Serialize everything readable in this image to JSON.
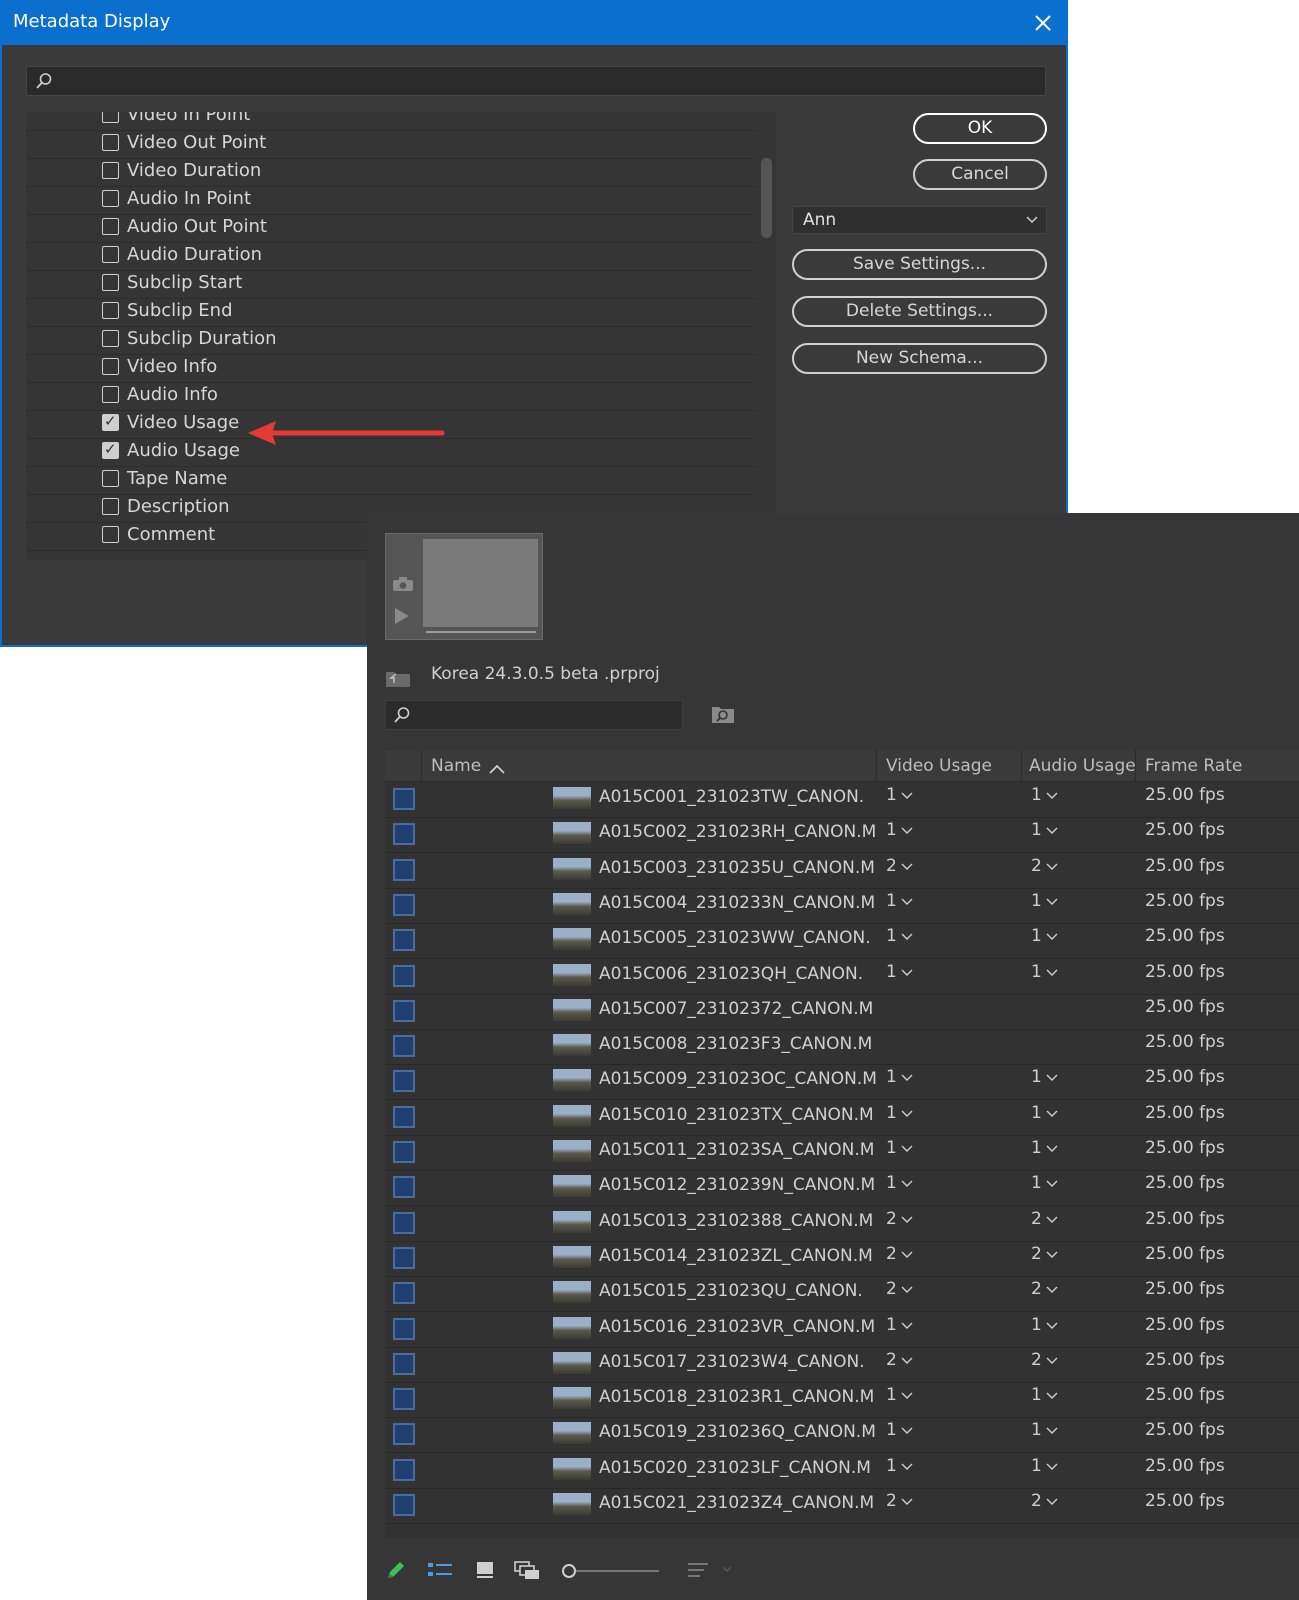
{
  "dialog": {
    "title": "Metadata Display",
    "search_placeholder": "",
    "fields": [
      {
        "label": "Video In Point",
        "checked": false
      },
      {
        "label": "Video Out Point",
        "checked": false
      },
      {
        "label": "Video Duration",
        "checked": false
      },
      {
        "label": "Audio In Point",
        "checked": false
      },
      {
        "label": "Audio Out Point",
        "checked": false
      },
      {
        "label": "Audio Duration",
        "checked": false
      },
      {
        "label": "Subclip Start",
        "checked": false
      },
      {
        "label": "Subclip End",
        "checked": false
      },
      {
        "label": "Subclip Duration",
        "checked": false
      },
      {
        "label": "Video Info",
        "checked": false
      },
      {
        "label": "Audio Info",
        "checked": false
      },
      {
        "label": "Video Usage",
        "checked": true
      },
      {
        "label": "Audio Usage",
        "checked": true
      },
      {
        "label": "Tape Name",
        "checked": false
      },
      {
        "label": "Description",
        "checked": false
      },
      {
        "label": "Comment",
        "checked": false
      }
    ],
    "ok_label": "OK",
    "cancel_label": "Cancel",
    "preset_value": "Ann",
    "save_label": "Save Settings...",
    "delete_label": "Delete Settings...",
    "schema_label": "New Schema...",
    "accent_color": "#0b6fce",
    "annotation_color": "#e53935"
  },
  "project": {
    "name": "Korea 24.3.0.5 beta .prproj",
    "search_placeholder": "",
    "columns": {
      "name": "Name",
      "video_usage": "Video Usage",
      "audio_usage": "Audio Usage",
      "frame_rate": "Frame Rate"
    },
    "rows": [
      {
        "name": "A015C001_231023TW_CANON.",
        "video": "1",
        "audio": "1",
        "fps": "25.00 fps"
      },
      {
        "name": "A015C002_231023RH_CANON.M",
        "video": "1",
        "audio": "1",
        "fps": "25.00 fps"
      },
      {
        "name": "A015C003_2310235U_CANON.M",
        "video": "2",
        "audio": "2",
        "fps": "25.00 fps"
      },
      {
        "name": "A015C004_2310233N_CANON.M",
        "video": "1",
        "audio": "1",
        "fps": "25.00 fps"
      },
      {
        "name": "A015C005_231023WW_CANON.",
        "video": "1",
        "audio": "1",
        "fps": "25.00 fps"
      },
      {
        "name": "A015C006_231023QH_CANON.",
        "video": "1",
        "audio": "1",
        "fps": "25.00 fps"
      },
      {
        "name": "A015C007_23102372_CANON.M",
        "video": "",
        "audio": "",
        "fps": "25.00 fps"
      },
      {
        "name": "A015C008_231023F3_CANON.M",
        "video": "",
        "audio": "",
        "fps": "25.00 fps"
      },
      {
        "name": "A015C009_231023OC_CANON.M",
        "video": "1",
        "audio": "1",
        "fps": "25.00 fps"
      },
      {
        "name": "A015C010_231023TX_CANON.M",
        "video": "1",
        "audio": "1",
        "fps": "25.00 fps"
      },
      {
        "name": "A015C011_231023SA_CANON.M",
        "video": "1",
        "audio": "1",
        "fps": "25.00 fps"
      },
      {
        "name": "A015C012_2310239N_CANON.M",
        "video": "1",
        "audio": "1",
        "fps": "25.00 fps"
      },
      {
        "name": "A015C013_23102388_CANON.M",
        "video": "2",
        "audio": "2",
        "fps": "25.00 fps"
      },
      {
        "name": "A015C014_231023ZL_CANON.M",
        "video": "2",
        "audio": "2",
        "fps": "25.00 fps"
      },
      {
        "name": "A015C015_231023QU_CANON.",
        "video": "2",
        "audio": "2",
        "fps": "25.00 fps"
      },
      {
        "name": "A015C016_231023VR_CANON.M",
        "video": "1",
        "audio": "1",
        "fps": "25.00 fps"
      },
      {
        "name": "A015C017_231023W4_CANON.",
        "video": "2",
        "audio": "2",
        "fps": "25.00 fps"
      },
      {
        "name": "A015C018_231023R1_CANON.M",
        "video": "1",
        "audio": "1",
        "fps": "25.00 fps"
      },
      {
        "name": "A015C019_2310236Q_CANON.M",
        "video": "1",
        "audio": "1",
        "fps": "25.00 fps"
      },
      {
        "name": "A015C020_231023LF_CANON.M",
        "video": "1",
        "audio": "1",
        "fps": "25.00 fps"
      },
      {
        "name": "A015C021_231023Z4_CANON.M",
        "video": "2",
        "audio": "2",
        "fps": "25.00 fps"
      }
    ],
    "toolbar_icons": [
      "pencil-icon",
      "list-view-icon",
      "icon-view-icon",
      "freeform-view-icon",
      "zoom-slider",
      "sort-icon"
    ]
  }
}
